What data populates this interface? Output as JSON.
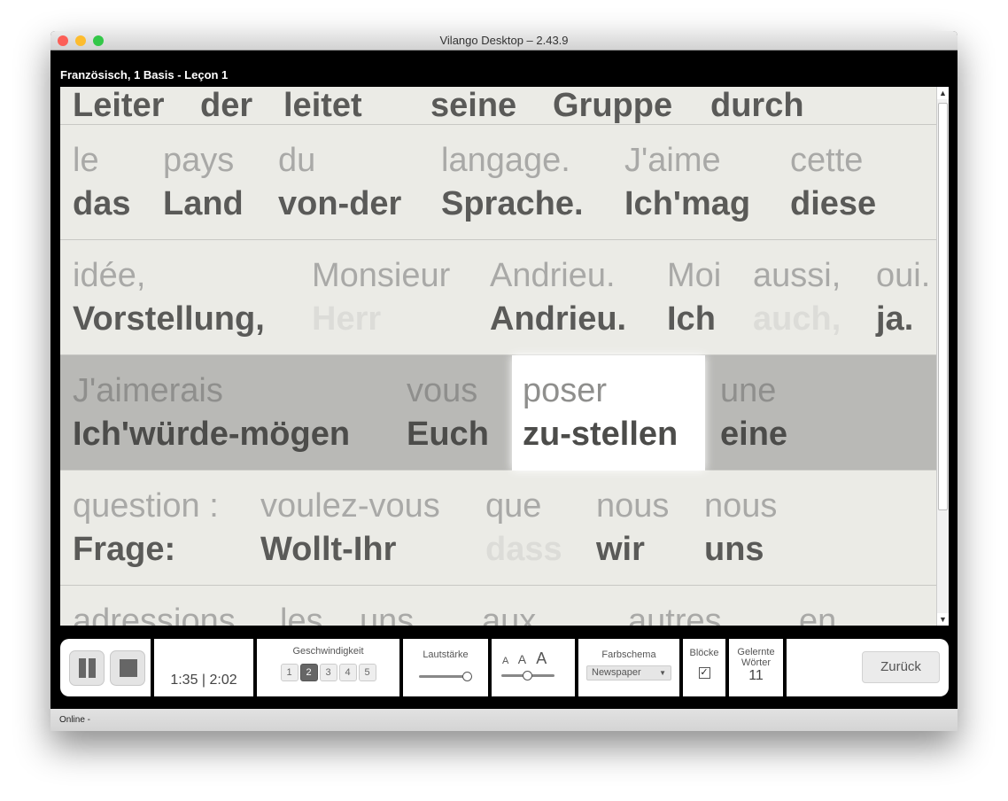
{
  "window": {
    "title": "Vilango Desktop – 2.43.9"
  },
  "lesson": {
    "title": "Französisch, 1 Basis - Leçon 1"
  },
  "rows": [
    {
      "words": [
        {
          "fr": "",
          "de": "Leiter"
        },
        {
          "fr": "",
          "de": "der"
        },
        {
          "fr": "",
          "de": "leitet"
        },
        {
          "fr": "",
          "de": "seine"
        },
        {
          "fr": "",
          "de": "Gruppe"
        },
        {
          "fr": "",
          "de": "durch"
        }
      ]
    },
    {
      "words": [
        {
          "fr": "le",
          "de": "das"
        },
        {
          "fr": "pays",
          "de": "Land"
        },
        {
          "fr": "du",
          "de": "von-der"
        },
        {
          "fr": "langage.",
          "de": "Sprache."
        },
        {
          "fr": "J'aime",
          "de": "Ich'mag"
        },
        {
          "fr": "cette",
          "de": "diese"
        }
      ]
    },
    {
      "words": [
        {
          "fr": "idée,",
          "de": "Vorstellung,"
        },
        {
          "fr": "Monsieur",
          "de": "Herr"
        },
        {
          "fr": "Andrieu.",
          "de": "Andrieu."
        },
        {
          "fr": "Moi",
          "de": "Ich"
        },
        {
          "fr": "aussi,",
          "de": "auch,"
        },
        {
          "fr": "oui.",
          "de": "ja."
        }
      ]
    },
    {
      "words": [
        {
          "fr": "J'aimerais",
          "de": "Ich'würde-mögen"
        },
        {
          "fr": "vous",
          "de": "Euch"
        },
        {
          "fr": "poser",
          "de": "zu-stellen"
        },
        {
          "fr": "une",
          "de": "eine"
        }
      ]
    },
    {
      "words": [
        {
          "fr": "question :",
          "de": "Frage:"
        },
        {
          "fr": "voulez-vous",
          "de": "Wollt-Ihr"
        },
        {
          "fr": "que",
          "de": "dass"
        },
        {
          "fr": "nous",
          "de": "wir"
        },
        {
          "fr": "nous",
          "de": "uns"
        }
      ]
    },
    {
      "words": [
        {
          "fr": "adressions",
          "de": ""
        },
        {
          "fr": "les",
          "de": ""
        },
        {
          "fr": "uns",
          "de": ""
        },
        {
          "fr": "aux",
          "de": ""
        },
        {
          "fr": "autres",
          "de": ""
        },
        {
          "fr": "en",
          "de": ""
        }
      ]
    }
  ],
  "controls": {
    "time": "1:35 | 2:02",
    "speed_label": "Geschwindigkeit",
    "speeds": [
      "1",
      "2",
      "3",
      "4",
      "5"
    ],
    "speed_selected": 2,
    "volume_label": "Lautstärke",
    "volume": 0.95,
    "font_sizes": [
      "A",
      "A",
      "A"
    ],
    "font_size_level": 0.5,
    "scheme_label": "Farbschema",
    "scheme_value": "Newspaper",
    "blocks_label": "Blöcke",
    "blocks_checked": true,
    "check_glyph": "✓",
    "learned_label1": "Gelernte",
    "learned_label2": "Wörter",
    "learned_count": "11",
    "back_label": "Zurück"
  },
  "status": "Online -"
}
